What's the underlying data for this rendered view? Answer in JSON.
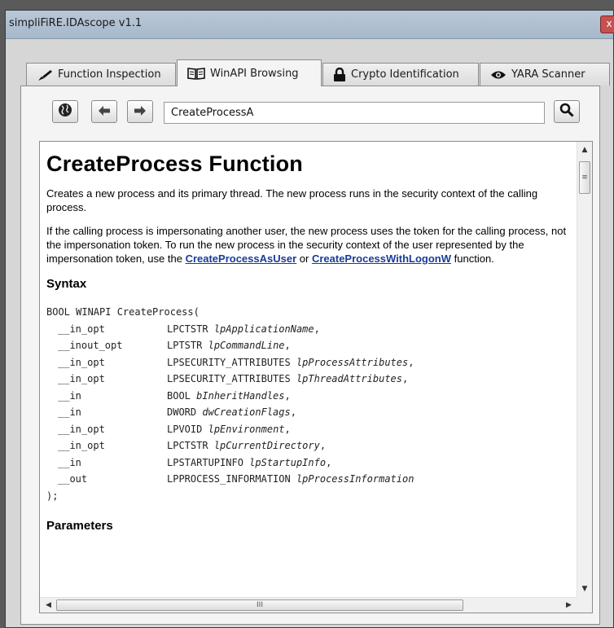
{
  "window": {
    "title": "simpliFiRE.IDAscope v1.1",
    "close_glyph": "x"
  },
  "tabs": [
    {
      "label": "Function Inspection",
      "icon": "brush-icon"
    },
    {
      "label": "WinAPI Browsing",
      "icon": "book-icon",
      "active": true
    },
    {
      "label": "Crypto Identification",
      "icon": "lock-icon"
    },
    {
      "label": "YARA Scanner",
      "icon": "eye-icon"
    }
  ],
  "toolbar": {
    "home_icon": "globe-icon",
    "back_icon": "arrow-left-icon",
    "forward_icon": "arrow-right-icon",
    "search_value": "CreateProcessA",
    "search_icon": "search-icon"
  },
  "doc": {
    "title": "CreateProcess Function",
    "para1": "Creates a new process and its primary thread. The new process runs in the security context of the calling process.",
    "para2_pre": "If the calling process is impersonating another user, the new process uses the token for the calling process, not the impersonation token. To run the new process in the security context of the user represented by the impersonation token, use the ",
    "link1": "CreateProcessAsUser",
    "para2_mid": " or ",
    "link2": "CreateProcessWithLogonW",
    "para2_post": " function.",
    "syntax_heading": "Syntax",
    "syntax_open": "BOOL WINAPI CreateProcess(",
    "params": [
      {
        "annot": "__in_opt",
        "type": "LPCTSTR",
        "name": "lpApplicationName",
        "sep": ","
      },
      {
        "annot": "__inout_opt",
        "type": "LPTSTR",
        "name": "lpCommandLine",
        "sep": ","
      },
      {
        "annot": "__in_opt",
        "type": "LPSECURITY_ATTRIBUTES",
        "name": "lpProcessAttributes",
        "sep": ","
      },
      {
        "annot": "__in_opt",
        "type": "LPSECURITY_ATTRIBUTES",
        "name": "lpThreadAttributes",
        "sep": ","
      },
      {
        "annot": "__in",
        "type": "BOOL",
        "name": "bInheritHandles",
        "sep": ","
      },
      {
        "annot": "__in",
        "type": "DWORD",
        "name": "dwCreationFlags",
        "sep": ","
      },
      {
        "annot": "__in_opt",
        "type": "LPVOID",
        "name": "lpEnvironment",
        "sep": ","
      },
      {
        "annot": "__in_opt",
        "type": "LPCTSTR",
        "name": "lpCurrentDirectory",
        "sep": ","
      },
      {
        "annot": "__in",
        "type": "LPSTARTUPINFO",
        "name": "lpStartupInfo",
        "sep": ","
      },
      {
        "annot": "__out",
        "type": "LPPROCESS_INFORMATION",
        "name": "lpProcessInformation",
        "sep": ""
      }
    ],
    "syntax_close": ");",
    "parameters_heading": "Parameters"
  },
  "scrollbars": {
    "grip_vertical": "≡",
    "grip_horizontal": "III"
  }
}
